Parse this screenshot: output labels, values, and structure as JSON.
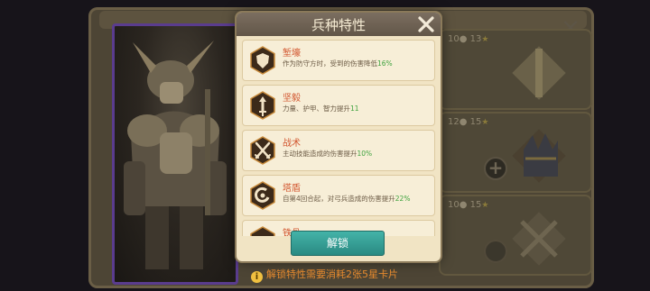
{
  "modal": {
    "title": "兵种特性",
    "unlock_label": "解锁",
    "traits": [
      {
        "name": "堑壕",
        "desc_pre": "作为防守方时，受到的伤害降低",
        "desc_val": "16%",
        "icon": "shield-icon"
      },
      {
        "name": "坚毅",
        "desc_pre": "力量、护甲、智力提升",
        "desc_val": "11",
        "icon": "sword-up-icon"
      },
      {
        "name": "战术",
        "desc_pre": "主动技能造成的伤害提升",
        "desc_val": "10%",
        "icon": "crossed-swords-icon"
      },
      {
        "name": "塔盾",
        "desc_pre": "自第4回合起，对弓兵造成的伤害提升",
        "desc_val": "22%",
        "icon": "tower-shield-icon"
      },
      {
        "name": "铁骨",
        "desc_pre": "",
        "desc_val": "",
        "icon": "bone-icon"
      }
    ]
  },
  "background": {
    "cards": [
      {
        "cost_a": "10",
        "cost_b": "13"
      },
      {
        "cost_a": "12",
        "cost_b": "15"
      },
      {
        "cost_a": "10",
        "cost_b": "15"
      }
    ],
    "hint": "10 解锁"
  },
  "note": "解锁特性需要消耗2张5星卡片",
  "colors": {
    "accent_teal": "#2f9c93",
    "trait_name": "#d2562f",
    "highlight_green": "#3fa33f",
    "note_orange": "#e68a2e"
  }
}
